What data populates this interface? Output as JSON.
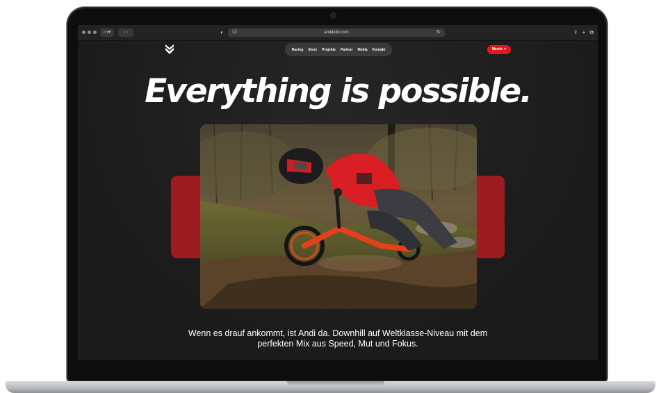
{
  "browser": {
    "url": "andikolb.com"
  },
  "nav": {
    "items": [
      "Racing",
      "Story",
      "Projekte",
      "Partner",
      "Media",
      "Kontakt"
    ],
    "merch_label": "Merch ↗"
  },
  "hero": {
    "title": "Everything is possible.",
    "description": "Wenn es drauf ankommt, ist Andi da. Downhill auf Weltklasse-Niveau mit dem perfekten Mix aus Speed, Mut und Fokus."
  },
  "icons": {
    "logo": "logo-icon",
    "back": "chevron-left-icon",
    "forward": "chevron-right-icon",
    "sidebar": "sidebar-icon",
    "reload": "reload-icon",
    "share": "share-icon",
    "new_tab": "plus-icon",
    "tabs": "tabs-icon",
    "privacy": "shield-icon"
  },
  "colors": {
    "accent": "#e2191f",
    "accent_dark": "#9c1c20",
    "background": "#1b1b1c"
  }
}
